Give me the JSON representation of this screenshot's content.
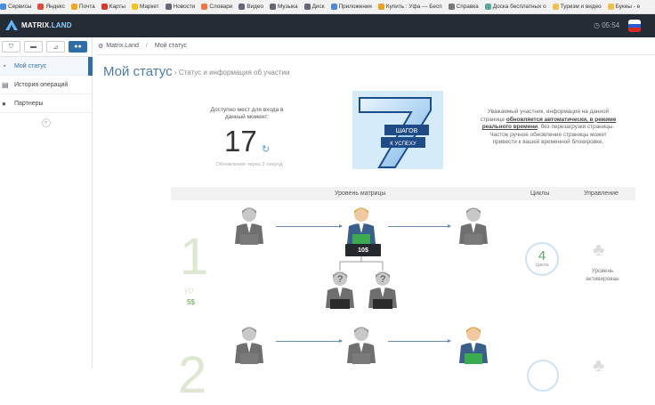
{
  "bookmarks": [
    {
      "label": "Сервисы",
      "icon_color": "#4a8be0"
    },
    {
      "label": "Яндекс",
      "icon_color": "#e14b3b"
    },
    {
      "label": "Почта",
      "icon_color": "#f1a81f"
    },
    {
      "label": "Карты",
      "icon_color": "#d33"
    },
    {
      "label": "Маркет",
      "icon_color": "#f3c51a"
    },
    {
      "label": "Новости",
      "icon_color": "#667"
    },
    {
      "label": "Словари",
      "icon_color": "#e74"
    },
    {
      "label": "Видео",
      "icon_color": "#667"
    },
    {
      "label": "Музыка",
      "icon_color": "#667"
    },
    {
      "label": "Диск",
      "icon_color": "#667"
    },
    {
      "label": "Приложения",
      "icon_color": "#4a8be0"
    },
    {
      "label": "Купить : Уфа — Бесп",
      "icon_color": "#f0a020"
    },
    {
      "label": "Справка",
      "icon_color": "#777"
    },
    {
      "label": "Доска бесплатных о",
      "icon_color": "#5a9"
    },
    {
      "label": "Туризм и видео",
      "icon_color": "#f0c04a"
    },
    {
      "label": "Букеы - е",
      "icon_color": "#f0c04a"
    }
  ],
  "header": {
    "logo_main": "MATRIX",
    "logo_tail": ".LAND",
    "time": "05:54"
  },
  "sidebar": {
    "tabs": [
      {
        "icon": "sitemap-icon"
      },
      {
        "icon": "wallet-icon"
      },
      {
        "icon": "chart-icon"
      },
      {
        "icon": "users-icon"
      }
    ],
    "items": [
      {
        "label": "Мой статус",
        "icon": "gauge-icon"
      },
      {
        "label": "История операций",
        "icon": "list-icon"
      },
      {
        "label": "Партнеры",
        "icon": "users-icon"
      }
    ],
    "collapse_glyph": "«"
  },
  "breadcrumb": {
    "root": "Matrix.Land",
    "current": "Мой статус",
    "sep": "/"
  },
  "page": {
    "title": "Мой статус",
    "subtitle": "› Статус и информация об участии"
  },
  "status": {
    "available_label": "Доступно мест для входа в данный момент:",
    "count": "17",
    "update_note": "Обновление через 2 секунд"
  },
  "banner": {
    "number": "7",
    "text1": "ШАГОВ",
    "text2": "К УСПЕХУ"
  },
  "notice": {
    "part1": "Уважаемый участник, информация на данной странице ",
    "bold": "обновляется автоматически, в режиме реального времени",
    "part2": ", без перезагрузки страницы. Частое ручное обновление страницы может привести к вашей временной блокировке."
  },
  "table": {
    "col_matrix": "Уровень матрицы",
    "col_cycles": "Циклы",
    "col_manage": "Управление"
  },
  "level1": {
    "number": "1",
    "label": "ур",
    "price": "5$",
    "center_price": "10$",
    "cycles": "4",
    "cycles_label": "Цикла",
    "status": "Уровень активирован"
  },
  "level2": {
    "number": "2"
  }
}
